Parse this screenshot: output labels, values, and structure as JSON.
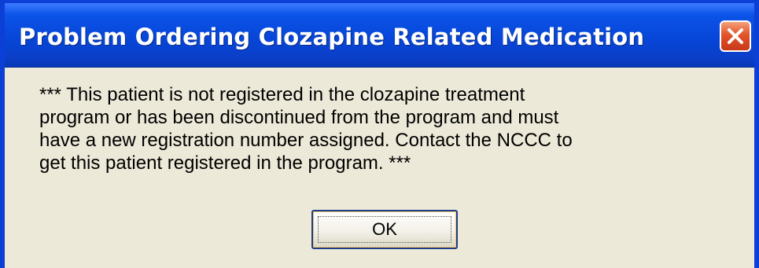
{
  "dialog": {
    "title": "Problem Ordering Clozapine Related Medication",
    "message": "*** This patient is not registered in the clozapine treatment\nprogram or has been discontinued from the program and must\nhave a new registration number assigned.  Contact the NCCC to\nget this patient registered in the program. ***",
    "ok_label": "OK",
    "close_icon": "close-icon"
  },
  "colors": {
    "titlebar": "#0b54e8",
    "close_button": "#e2542a",
    "dialog_background": "#ece9d8"
  }
}
